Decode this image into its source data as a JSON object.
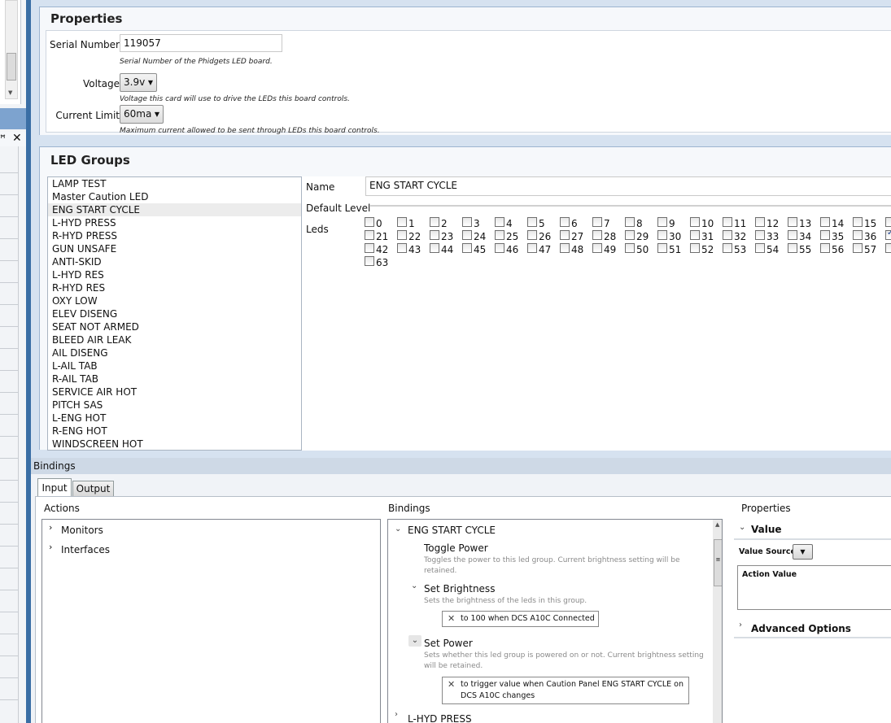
{
  "left_panel": {
    "pin_glyph": "ꟸ",
    "close_glyph": "✕"
  },
  "properties": {
    "title": "Properties",
    "serial_label": "Serial Number",
    "serial_value": "119057",
    "serial_help": "Serial Number of the Phidgets LED board.",
    "voltage_label": "Voltage",
    "voltage_value": "3.9v",
    "voltage_help": "Voltage this card will use to drive the LEDs this board controls.",
    "current_label": "Current Limit",
    "current_value": "60ma",
    "current_help": "Maximum current allowed to be sent through LEDs this board controls."
  },
  "led_groups": {
    "title": "LED Groups",
    "items": [
      "LAMP TEST",
      "Master Caution LED",
      "ENG START CYCLE",
      "L-HYD PRESS",
      "R-HYD PRESS",
      "GUN UNSAFE",
      "ANTI-SKID",
      "L-HYD RES",
      "R-HYD RES",
      "OXY LOW",
      "ELEV DISENG",
      "SEAT NOT ARMED",
      "BLEED AIR LEAK",
      "AIL DISENG",
      "L-AIL TAB",
      "R-AIL TAB",
      "SERVICE AIR HOT",
      "PITCH SAS",
      "L-ENG HOT",
      "R-ENG HOT",
      "WINDSCREEN HOT"
    ],
    "selected_index": 2,
    "name_label": "Name",
    "name_value": "ENG START CYCLE",
    "default_level_label": "Default Level",
    "leds_label": "Leds",
    "led_numbers": [
      "0",
      "1",
      "2",
      "3",
      "4",
      "5",
      "6",
      "7",
      "8",
      "9",
      "10",
      "11",
      "12",
      "13",
      "14",
      "15",
      "21",
      "22",
      "23",
      "24",
      "25",
      "26",
      "27",
      "28",
      "29",
      "30",
      "31",
      "32",
      "33",
      "34",
      "35",
      "36",
      "42",
      "43",
      "44",
      "45",
      "46",
      "47",
      "48",
      "49",
      "50",
      "51",
      "52",
      "53",
      "54",
      "55",
      "56",
      "57",
      "63"
    ],
    "partial_checked": true
  },
  "bindings": {
    "title": "Bindings",
    "tabs": [
      "Input",
      "Output"
    ],
    "active_tab": "Input",
    "actions_header": "Actions",
    "bindings_header": "Bindings",
    "properties_header": "Properties",
    "actions": [
      "Monitors",
      "Interfaces"
    ],
    "group_name": "ENG START CYCLE",
    "toggle_power": "Toggle Power",
    "toggle_power_desc": "Toggles the power to this led group.  Current brightness setting will be retained.",
    "set_brightness": "Set Brightness",
    "set_brightness_desc": "Sets the brightness of the leds in this group.",
    "brightness_binding": "to 100 when DCS A10C Connected",
    "set_power": "Set Power",
    "set_power_desc": "Sets whether this led group is powered on or not. Current brightness setting will be retained.",
    "power_binding": "to trigger value when Caution Panel ENG START CYCLE on DCS A10C changes",
    "next_group": "L-HYD PRESS",
    "value_section": "Value",
    "value_source_label": "Value Source",
    "action_value_label": "Action Value",
    "advanced_options": "Advanced Options"
  }
}
